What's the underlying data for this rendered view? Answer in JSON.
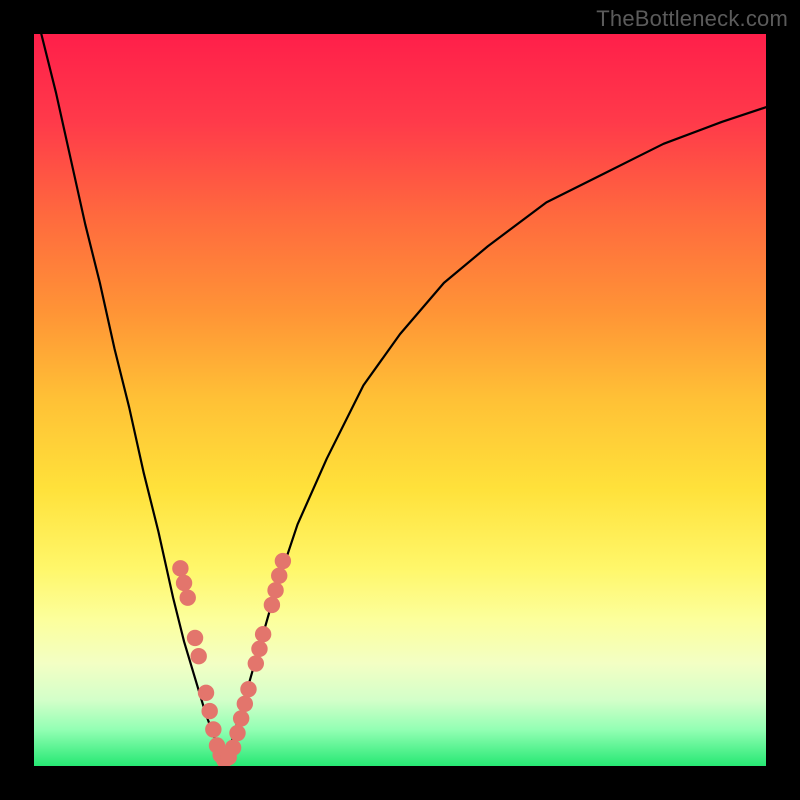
{
  "watermark": "TheBottleneck.com",
  "colors": {
    "frame": "#000000",
    "curve_stroke": "#000000",
    "marker_fill": "#e3756c",
    "watermark_text": "#5b5b5b",
    "gradient_stops": [
      {
        "offset": 0.0,
        "color": "#ff1f4a"
      },
      {
        "offset": 0.12,
        "color": "#ff3a4a"
      },
      {
        "offset": 0.25,
        "color": "#ff6a3e"
      },
      {
        "offset": 0.38,
        "color": "#ff9436"
      },
      {
        "offset": 0.5,
        "color": "#ffc136"
      },
      {
        "offset": 0.62,
        "color": "#ffe13a"
      },
      {
        "offset": 0.73,
        "color": "#fff76a"
      },
      {
        "offset": 0.8,
        "color": "#fcff9c"
      },
      {
        "offset": 0.86,
        "color": "#f3ffc4"
      },
      {
        "offset": 0.91,
        "color": "#d3ffc9"
      },
      {
        "offset": 0.95,
        "color": "#93ffb4"
      },
      {
        "offset": 1.0,
        "color": "#26e873"
      }
    ]
  },
  "chart_data": {
    "type": "line",
    "title": "",
    "xlabel": "",
    "ylabel": "",
    "xlim": [
      0,
      100
    ],
    "ylim": [
      0,
      100
    ],
    "grid": false,
    "series": [
      {
        "name": "left-branch",
        "x": [
          1,
          3,
          5,
          7,
          9,
          11,
          13,
          15,
          17,
          19,
          20.5,
          22,
          23.5,
          25,
          26
        ],
        "y": [
          100,
          92,
          83,
          74,
          66,
          57,
          49,
          40,
          32,
          23,
          17,
          12,
          7,
          3,
          0
        ]
      },
      {
        "name": "right-branch",
        "x": [
          26,
          27.5,
          29,
          31,
          33,
          36,
          40,
          45,
          50,
          56,
          62,
          70,
          78,
          86,
          94,
          100
        ],
        "y": [
          0,
          5,
          10,
          17,
          24,
          33,
          42,
          52,
          59,
          66,
          71,
          77,
          81,
          85,
          88,
          90
        ]
      }
    ],
    "markers": [
      {
        "x": 20.0,
        "y": 27.0
      },
      {
        "x": 20.5,
        "y": 25.0
      },
      {
        "x": 21.0,
        "y": 23.0
      },
      {
        "x": 22.0,
        "y": 17.5
      },
      {
        "x": 22.5,
        "y": 15.0
      },
      {
        "x": 23.5,
        "y": 10.0
      },
      {
        "x": 24.0,
        "y": 7.5
      },
      {
        "x": 24.5,
        "y": 5.0
      },
      {
        "x": 25.0,
        "y": 2.8
      },
      {
        "x": 25.5,
        "y": 1.5
      },
      {
        "x": 26.0,
        "y": 0.8
      },
      {
        "x": 26.6,
        "y": 1.2
      },
      {
        "x": 27.2,
        "y": 2.5
      },
      {
        "x": 27.8,
        "y": 4.5
      },
      {
        "x": 28.3,
        "y": 6.5
      },
      {
        "x": 28.8,
        "y": 8.5
      },
      {
        "x": 29.3,
        "y": 10.5
      },
      {
        "x": 30.3,
        "y": 14.0
      },
      {
        "x": 30.8,
        "y": 16.0
      },
      {
        "x": 31.3,
        "y": 18.0
      },
      {
        "x": 32.5,
        "y": 22.0
      },
      {
        "x": 33.0,
        "y": 24.0
      },
      {
        "x": 33.5,
        "y": 26.0
      },
      {
        "x": 34.0,
        "y": 28.0
      }
    ]
  }
}
